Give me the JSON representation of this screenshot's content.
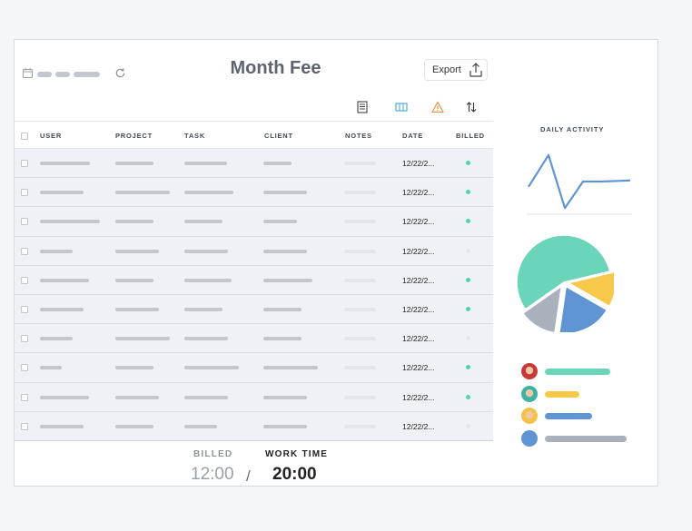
{
  "header": {
    "title": "Month Fee",
    "export_label": "Export"
  },
  "icons": {
    "calendar": "calendar-icon",
    "refresh": "refresh-icon",
    "export": "upload-icon",
    "toolbar": [
      "document-icon",
      "columns-icon",
      "warning-icon",
      "sort-icon"
    ]
  },
  "table": {
    "columns": [
      "USER",
      "PROJECT",
      "TASK",
      "CLIENT",
      "NOTES",
      "DATE",
      "BILLED"
    ],
    "rows": [
      {
        "date": "12/22/2...",
        "billed": true
      },
      {
        "date": "12/22/2...",
        "billed": true
      },
      {
        "date": "12/22/2...",
        "billed": true
      },
      {
        "date": "12/22/2...",
        "billed": false
      },
      {
        "date": "12/22/2...",
        "billed": true
      },
      {
        "date": "12/22/2...",
        "billed": true
      },
      {
        "date": "12/22/2...",
        "billed": false
      },
      {
        "date": "12/22/2...",
        "billed": true
      },
      {
        "date": "12/22/2...",
        "billed": true
      },
      {
        "date": "12/22/2...",
        "billed": false
      }
    ]
  },
  "footer": {
    "billed_label": "BILLED",
    "billed_value": "12:00",
    "separator": "/",
    "work_label": "WORK TIME",
    "work_value": "20:00"
  },
  "daily_activity": {
    "label": "DAILY ACTIVITY"
  },
  "colors": {
    "teal": "#6ad5b8",
    "yellow": "#f8c84b",
    "blue": "#5f95d3",
    "gray": "#a9b1bd",
    "billed_dot": "#52d4a0",
    "unbilled_dot": "#e3e7eb"
  },
  "chart_data": [
    {
      "type": "line",
      "x": [
        1,
        2,
        3,
        4,
        5,
        6
      ],
      "series": [
        {
          "values": [
            25,
            55,
            5,
            30,
            30,
            31
          ]
        }
      ],
      "ylim": [
        0,
        60
      ]
    },
    {
      "type": "pie",
      "categories": [
        "teal",
        "yellow",
        "blue",
        "gray"
      ],
      "values": [
        56,
        12,
        19,
        13
      ]
    }
  ]
}
